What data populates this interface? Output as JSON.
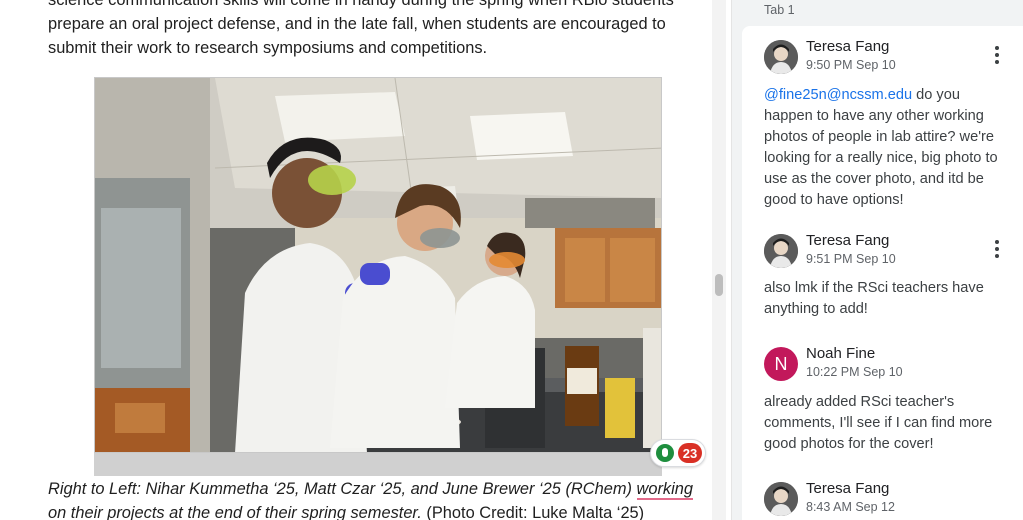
{
  "document": {
    "paragraph_lines": [
      "science communication skills will come in handy during the spring when RBio students",
      "prepare an oral project defense, and in the late fall, when students are encouraged to",
      "submit their work to research symposiums and competitions."
    ],
    "photo": {
      "description_icon": "lab-photo-image",
      "reaction_count": "23"
    },
    "caption": {
      "italic_prefix": "Right to Left: Nihar Kummetha ‘25, Matt Czar ‘25, and June Brewer ‘25 (RChem) ",
      "underlined_word": "working",
      "line2_italic": "on their projects at the end of their spring semester.",
      "line2_credit": " (Photo Credit: Luke Malta ‘25)"
    }
  },
  "comments_panel": {
    "tab_label": "Tab 1",
    "comments": [
      {
        "author": "Teresa Fang",
        "time": "9:50 PM Sep 10",
        "mention": "@fine25n@ncssm.edu",
        "lines": [
          " do you",
          "happen to have any other working",
          "photos of people in lab attire? we're",
          "looking for a really nice, big photo to",
          "use as the cover photo, and itd be",
          "good to have options!"
        ]
      },
      {
        "author": "Teresa Fang",
        "time": "9:51 PM Sep 10",
        "lines": [
          "also lmk if the RSci teachers have",
          "anything to add!"
        ]
      },
      {
        "author": "Noah Fine",
        "avatar_letter": "N",
        "time": "10:22 PM Sep 10",
        "lines": [
          "already added RSci teacher's",
          "comments, I'll see if I can find more",
          "good photos for the cover!"
        ]
      },
      {
        "author": "Teresa Fang",
        "time": "8:43 AM Sep 12"
      }
    ]
  },
  "colors": {
    "mention": "#1a73e8",
    "avatar_noah": "#c2185b",
    "badge": "#d93025",
    "emoji_add": "#1e8e3e"
  }
}
